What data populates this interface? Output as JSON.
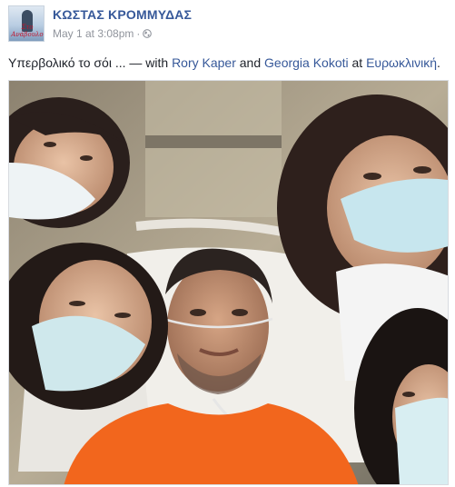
{
  "post": {
    "author": "ΚΩΣΤΑΣ ΚΡΟΜΜΥΔΑΣ",
    "avatar_caption": "Στο Ανάβουλο",
    "timestamp": "May 1 at 3:08pm",
    "separator": "·",
    "privacy_icon": "globe-icon",
    "text_start": "Υπερβολικό το σόι ... — with ",
    "tagged": [
      "Rory Kaper",
      "Georgia Kokoti"
    ],
    "text_and": " and ",
    "text_at": " at ",
    "place": "Ευρωκλινική",
    "text_end": "."
  },
  "colors": {
    "link": "#365899",
    "meta": "#90949c",
    "text": "#1d2129"
  }
}
